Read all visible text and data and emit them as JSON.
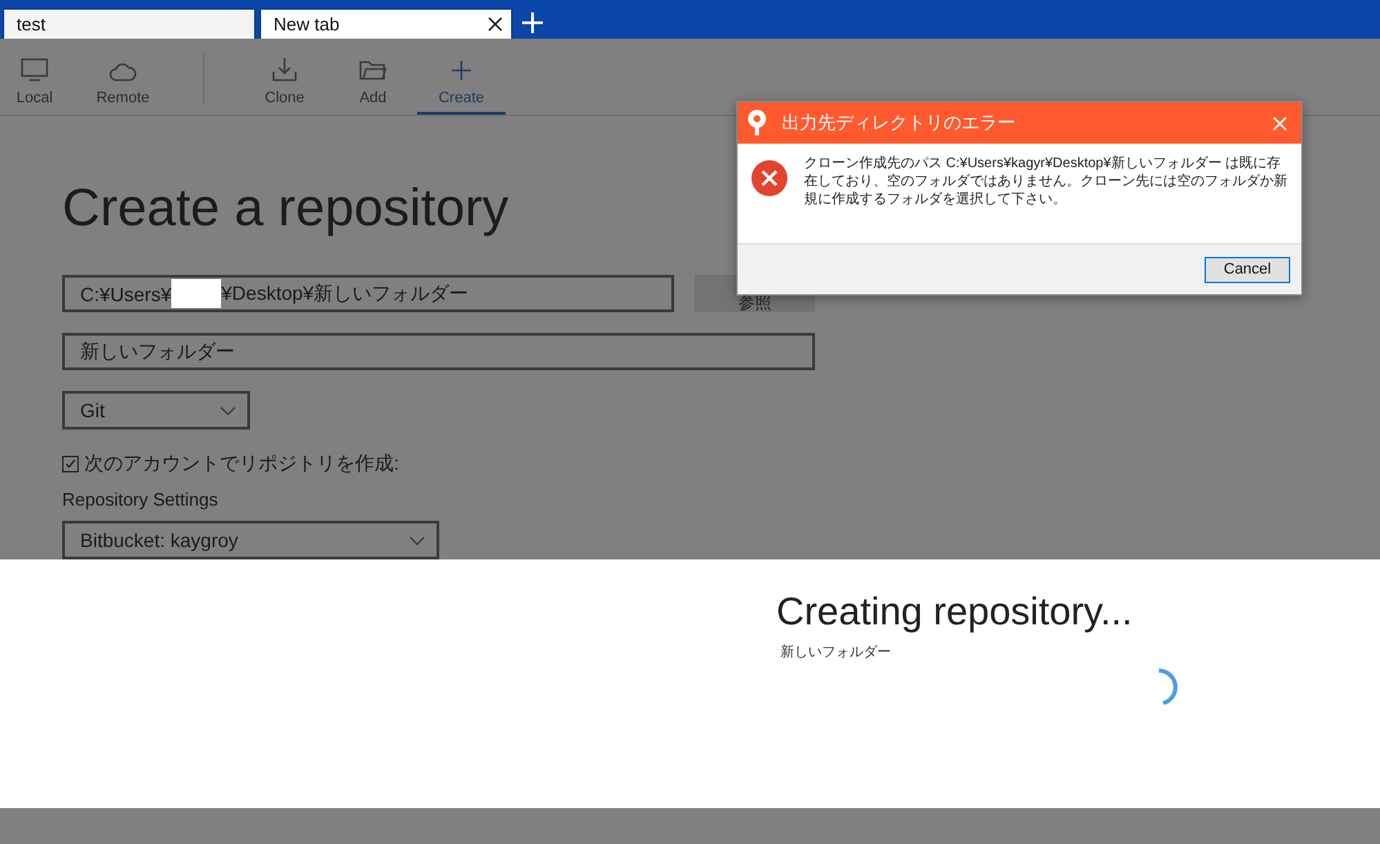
{
  "tabs": [
    {
      "label": "test",
      "selected": false,
      "closable": false
    },
    {
      "label": "New tab",
      "selected": true,
      "closable": true
    }
  ],
  "toolbar": {
    "groups": [
      [
        {
          "kind": "local",
          "label": "Local",
          "selected": false
        },
        {
          "kind": "remote",
          "label": "Remote",
          "selected": false
        }
      ],
      [
        {
          "kind": "clone",
          "label": "Clone",
          "selected": false
        },
        {
          "kind": "add",
          "label": "Add",
          "selected": false
        },
        {
          "kind": "create",
          "label": "Create",
          "selected": true
        }
      ]
    ]
  },
  "form": {
    "title": "Create a repository",
    "path_field": {
      "value_start": "C:¥Users¥",
      "value_end": "¥Desktop¥新しいフォルダー",
      "redacted": true
    },
    "browse_button": "参照",
    "name_field": {
      "value": "新しいフォルダー"
    },
    "vcs_select": {
      "value": "Git"
    },
    "account_checkbox": {
      "label": "次のアカウントでリポジトリを作成:",
      "checked": true
    },
    "settings_label": "Repository Settings",
    "account_select": {
      "value": "Bitbucket: kaygroy"
    }
  },
  "progress": {
    "title": "Creating repository...",
    "subtitle": "新しいフォルダー"
  },
  "dialog": {
    "title": "出力先ディレクトリのエラー",
    "message": "クローン作成先のパス C:¥Users¥kagyr¥Desktop¥新しいフォルダー は既に存在しており、空のフォルダではありません。クローン先には空のフォルダか新規に作成するフォルダを選択して下さい。",
    "buttons": [
      "Cancel"
    ]
  }
}
